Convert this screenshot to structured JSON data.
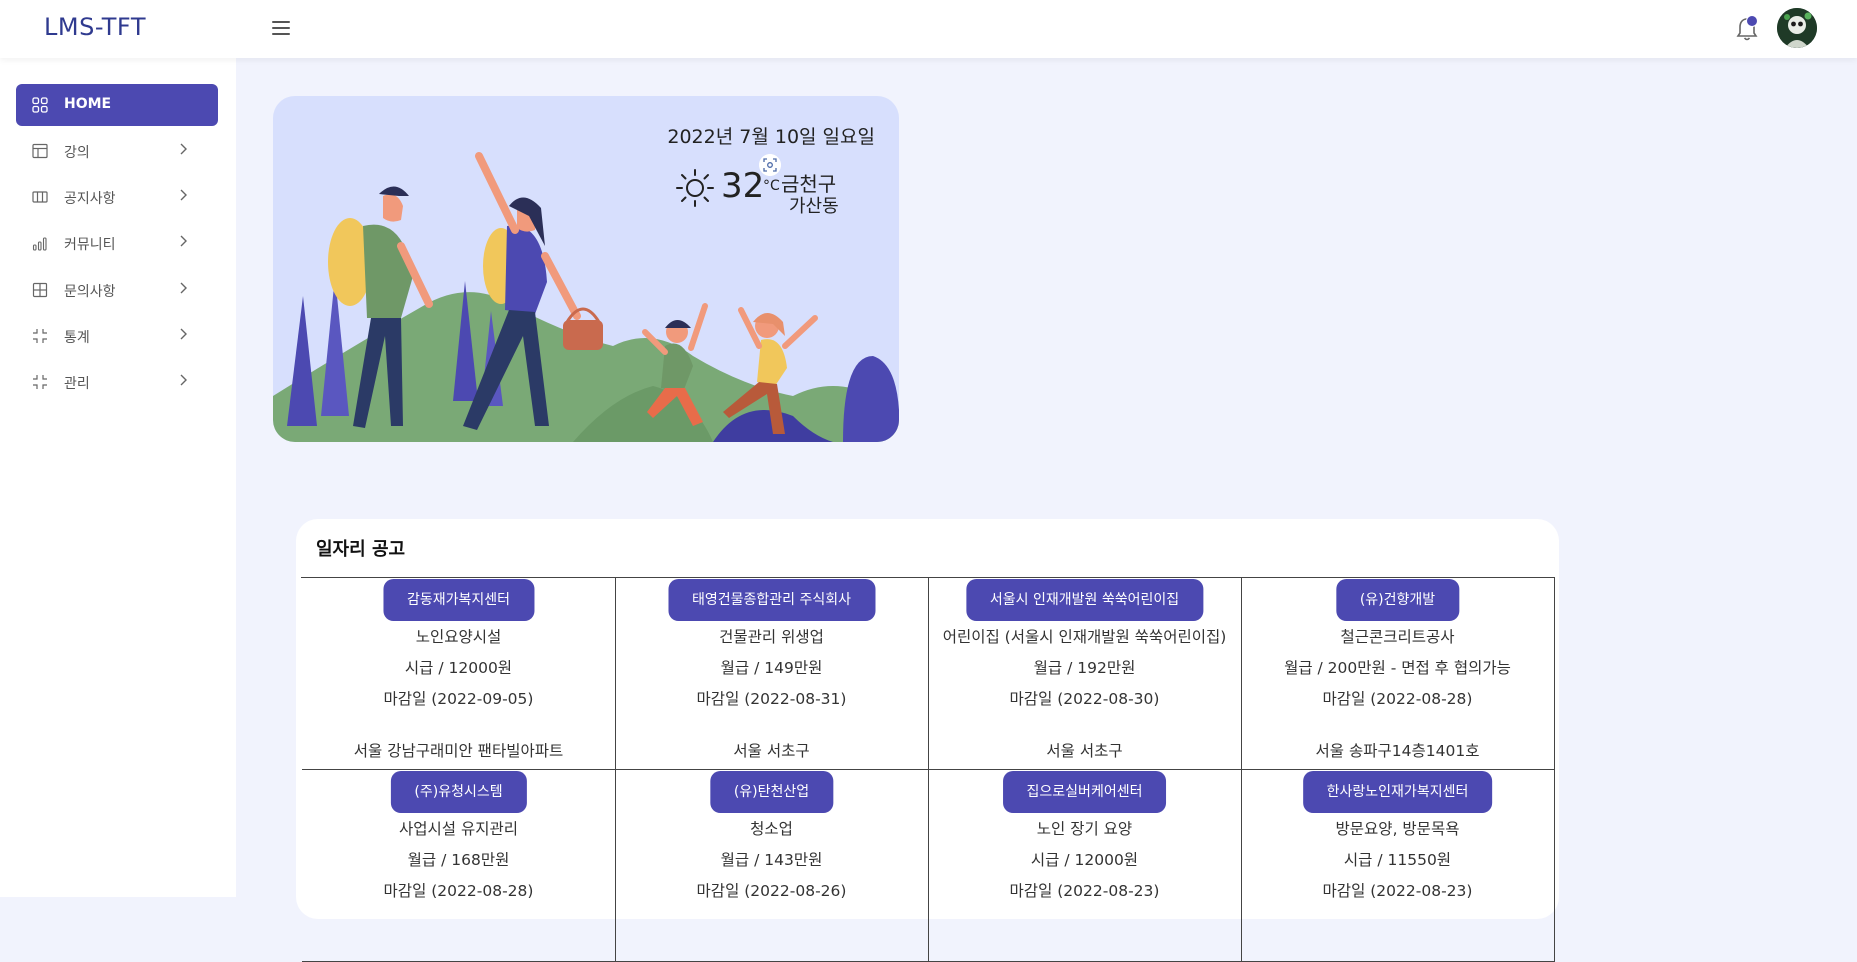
{
  "app": {
    "brand": "LMS-TFT"
  },
  "sidebar": {
    "items": [
      {
        "label": "HOME",
        "icon": "grid-icon",
        "active": true
      },
      {
        "label": "강의",
        "icon": "layout-icon"
      },
      {
        "label": "공지사항",
        "icon": "columns-icon"
      },
      {
        "label": "커뮤니티",
        "icon": "bar-chart-icon"
      },
      {
        "label": "문의사항",
        "icon": "table-icon"
      },
      {
        "label": "통계",
        "icon": "expand-icon"
      },
      {
        "label": "관리",
        "icon": "expand-icon"
      }
    ]
  },
  "hero": {
    "date": "2022년 7월 10일 일요일",
    "temperature": "32",
    "unit": "°C",
    "location_gu": "금천구",
    "location_dong": "가산동",
    "weather_icon": "sun-icon"
  },
  "jobs": {
    "title": "일자리 공고",
    "postings": [
      {
        "company": "감동재가복지센터",
        "job": "노인요양시설",
        "pay": "시급 / 12000원",
        "deadline": "마감일 (2022-09-05)",
        "address": "서울 강남구래미안 팬타빌아파트"
      },
      {
        "company": "태영건물종합관리 주식회사",
        "job": "건물관리 위생업",
        "pay": "월급 / 149만원",
        "deadline": "마감일 (2022-08-31)",
        "address": "서울 서초구"
      },
      {
        "company": "서울시 인재개발원 쑥쑥어린이집",
        "job": "어린이집 (서울시 인재개발원 쑥쑥어린이집)",
        "pay": "월급 / 192만원",
        "deadline": "마감일 (2022-08-30)",
        "address": "서울 서초구"
      },
      {
        "company": "(유)건향개발",
        "job": "철근콘크리트공사",
        "pay": "월급 / 200만원 - 면접 후 협의가능",
        "deadline": "마감일 (2022-08-28)",
        "address": "서울 송파구14층1401호"
      },
      {
        "company": "(주)유청시스템",
        "job": "사업시설 유지관리",
        "pay": "월급 / 168만원",
        "deadline": "마감일 (2022-08-28)",
        "address": ""
      },
      {
        "company": "(유)탄천산업",
        "job": "청소업",
        "pay": "월급 / 143만원",
        "deadline": "마감일 (2022-08-26)",
        "address": ""
      },
      {
        "company": "집으로실버케어센터",
        "job": "노인 장기 요양",
        "pay": "시급 / 12000원",
        "deadline": "마감일 (2022-08-23)",
        "address": ""
      },
      {
        "company": "한사랑노인재가복지센터",
        "job": "방문요양, 방문목욕",
        "pay": "시급 / 11550원",
        "deadline": "마감일 (2022-08-23)",
        "address": ""
      }
    ]
  },
  "colors": {
    "accent": "#4c49b1",
    "background": "#f1f3fd",
    "hero_bg": "#d7dffd"
  }
}
